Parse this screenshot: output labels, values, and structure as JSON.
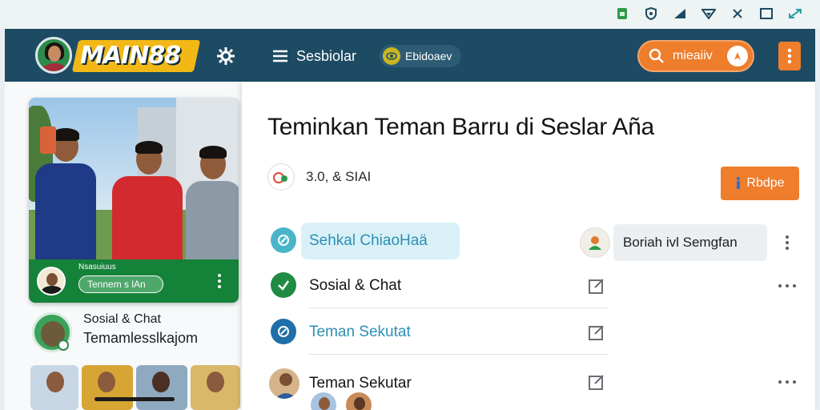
{
  "status_bar": {
    "icons": [
      "sim-icon",
      "shield-icon",
      "signal-icon",
      "wifi-icon",
      "close-icon",
      "window-icon",
      "expand-icon"
    ]
  },
  "topbar": {
    "brand": "MAIN88",
    "menu_label": "Sesbiolar",
    "chip_label": "Ebidoaev",
    "search_label": "mieaiiv",
    "colors": {
      "bar": "#1d4b63",
      "accent": "#ee7d2c",
      "brand_yellow": "#f2b816"
    }
  },
  "hero": {
    "caption": "Nsasuiuus",
    "chip_label": "Tennem s lAn"
  },
  "profile": {
    "name": "Sosial & Chat",
    "subtitle": "Temamlesslkajom"
  },
  "main": {
    "title": "Teminkan Teman Barru di Seslar Aña",
    "meta_text": "3.0, & SIAI",
    "action_label": "Rbdpe",
    "items": [
      {
        "label": "Sehkal ChiaoHaä",
        "icon": "sync-icon",
        "highlighted": true
      },
      {
        "label": "Sosial & Chat",
        "icon": "check-icon"
      },
      {
        "label": "Teman Sekutat",
        "icon": "compass-icon"
      },
      {
        "label": "Teman Sekutar",
        "icon": "avatar"
      }
    ],
    "contact": {
      "label": "Boriah ivl Semgfan"
    }
  }
}
